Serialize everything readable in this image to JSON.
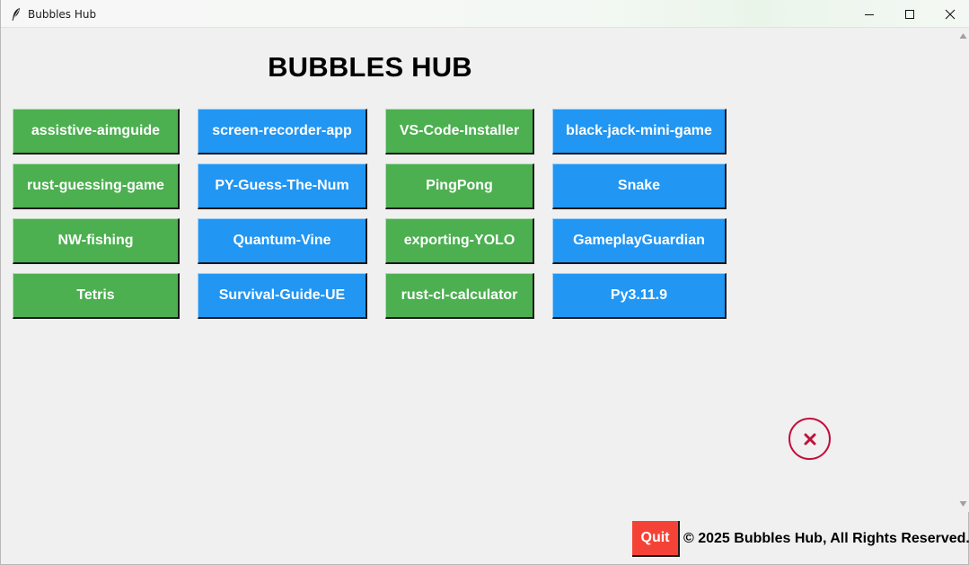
{
  "window": {
    "title": "Bubbles Hub"
  },
  "main": {
    "heading": "BUBBLES HUB",
    "apps": [
      {
        "label": "assistive-aimguide",
        "color": "#4caf50"
      },
      {
        "label": "screen-recorder-app",
        "color": "#2196f3"
      },
      {
        "label": "VS-Code-Installer",
        "color": "#4caf50"
      },
      {
        "label": "black-jack-mini-game",
        "color": "#2196f3"
      },
      {
        "label": "rust-guessing-game",
        "color": "#4caf50"
      },
      {
        "label": "PY-Guess-The-Num",
        "color": "#2196f3"
      },
      {
        "label": "PingPong",
        "color": "#4caf50"
      },
      {
        "label": "Snake",
        "color": "#2196f3"
      },
      {
        "label": "NW-fishing",
        "color": "#4caf50"
      },
      {
        "label": "Quantum-Vine",
        "color": "#2196f3"
      },
      {
        "label": "exporting-YOLO",
        "color": "#4caf50"
      },
      {
        "label": "GameplayGuardian",
        "color": "#2196f3"
      },
      {
        "label": "Tetris",
        "color": "#4caf50"
      },
      {
        "label": "Survival-Guide-UE",
        "color": "#2196f3"
      },
      {
        "label": "rust-cl-calculator",
        "color": "#4caf50"
      },
      {
        "label": "Py3.11.9",
        "color": "#2196f3"
      }
    ],
    "close_icon": "close-x-icon",
    "close_color": "#c0103c"
  },
  "footer": {
    "quit_label": "Quit",
    "quit_color": "#f44336",
    "copyright": "© 2025 Bubbles Hub, All Rights Reserved."
  }
}
